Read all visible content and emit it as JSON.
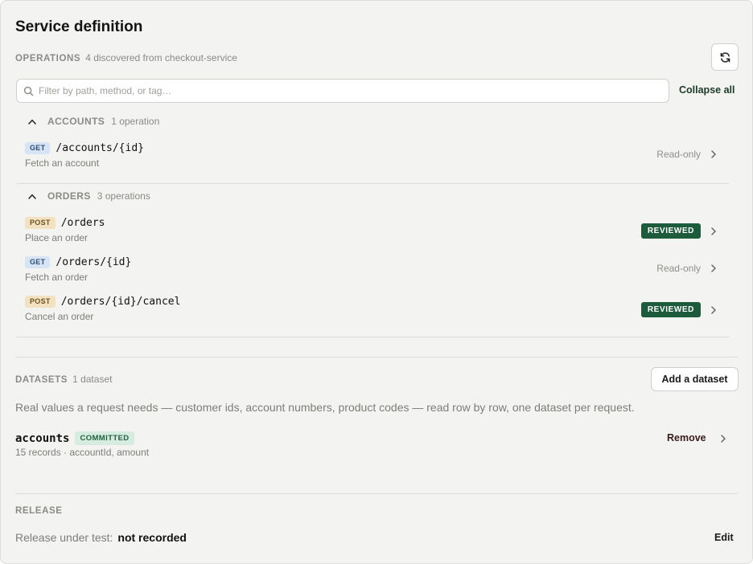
{
  "header": {
    "title": "Service definition"
  },
  "operations": {
    "label": "OPERATIONS",
    "meta": "4 discovered from checkout-service",
    "search_placeholder": "Filter by path, method, or tag…",
    "collapse_label": "Collapse all",
    "groups": [
      {
        "name": "ACCOUNTS",
        "count": "1 operation",
        "items": [
          {
            "method": "GET",
            "path": "/accounts/{id}",
            "desc": "Fetch an account",
            "status": "Read-only"
          }
        ]
      },
      {
        "name": "ORDERS",
        "count": "3 operations",
        "items": [
          {
            "method": "POST",
            "path": "/orders",
            "desc": "Place an order",
            "status": "REVIEWED"
          },
          {
            "method": "GET",
            "path": "/orders/{id}",
            "desc": "Fetch an order",
            "status": "Read-only"
          },
          {
            "method": "POST",
            "path": "/orders/{id}/cancel",
            "desc": "Cancel an order",
            "status": "REVIEWED"
          }
        ]
      }
    ]
  },
  "datasets": {
    "label": "DATASETS",
    "meta": "1 dataset",
    "add_label": "Add a dataset",
    "description": "Real values a request needs — customer ids, account numbers, product codes — read row by row, one dataset per request.",
    "items": [
      {
        "name": "accounts",
        "badge": "COMMITTED",
        "meta": "15 records · accountId, amount",
        "action": "Remove"
      }
    ]
  },
  "release": {
    "label": "RELEASE",
    "text": "Release under test:",
    "value": "not recorded",
    "edit_label": "Edit"
  },
  "colors": {
    "reviewed_bg": "#1e5a3c",
    "committed_bg": "#d6ece0",
    "get_bg": "#d6e4f5",
    "post_bg": "#f3e2c2"
  }
}
